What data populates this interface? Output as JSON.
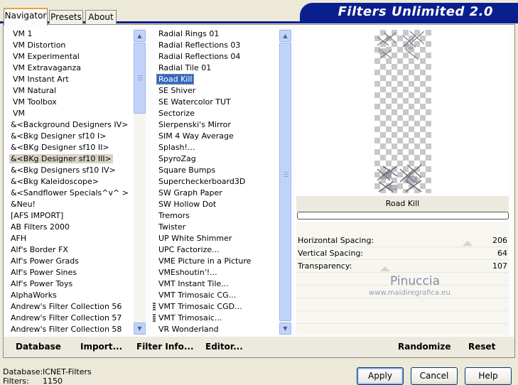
{
  "header": {
    "title": "Filters Unlimited 2.0"
  },
  "tabs": [
    {
      "label": "Navigator",
      "active": true
    },
    {
      "label": "Presets",
      "active": false
    },
    {
      "label": "About",
      "active": false
    }
  ],
  "categories": [
    "VM 1",
    "VM Distortion",
    "VM Experimental",
    "VM Extravaganza",
    "VM Instant Art",
    "VM Natural",
    "VM Toolbox",
    "VM",
    "&<Background Designers IV>",
    "&<Bkg Designer sf10 I>",
    "&<BKg Designer sf10 II>",
    "&<BKg Designer sf10 III>",
    "&<Bkg Designers sf10 IV>",
    "&<Bkg Kaleidoscope>",
    "&<Sandflower Specials^v^ >",
    "&Neu!",
    "[AFS IMPORT]",
    "AB Filters 2000",
    "AFH",
    "Alf's Border FX",
    "Alf's Power Grads",
    "Alf's Power Sines",
    "Alf's Power Toys",
    "AlphaWorks",
    "Andrew's Filter Collection 56",
    "Andrew's Filter Collection 57",
    "Andrew's Filter Collection 58"
  ],
  "filters": [
    "Radial  Rings 01",
    "Radial Reflections 03",
    "Radial Reflections 04",
    "Radial Tile 01",
    "Road Kill",
    "SE Shiver",
    "SE Watercolor TUT",
    "Sectorize",
    "Sierpenski's Mirror",
    "SIM 4 Way Average",
    "Splash!...",
    "SpyroZag",
    "Square Bumps",
    "Supercheckerboard3D",
    "SW Graph Paper",
    "SW Hollow Dot",
    "Tremors",
    "Twister",
    "UP White Shimmer",
    "UPC Factorize...",
    "VME Picture in a Picture",
    "VMEshoutin'!...",
    "VMT Instant Tile...",
    "VMT Trimosaic CG...",
    "VMT Trimosaic CGD...",
    "VMT Trimosaic...",
    "VR Wonderland"
  ],
  "selected_filter": "Road Kill",
  "params": [
    {
      "label": "Horizontal Spacing:",
      "value": "206"
    },
    {
      "label": "Vertical Spacing:",
      "value": "64"
    },
    {
      "label": "Transparency:",
      "value": "107"
    }
  ],
  "watermark": {
    "name": "Pinuccia",
    "url": "www.maidiregrafica.eu"
  },
  "toolbar": {
    "database": "Database",
    "import": "Import...",
    "filter_info": "Filter Info...",
    "editor": "Editor...",
    "randomize": "Randomize",
    "reset": "Reset"
  },
  "status": {
    "database_label": "Database:",
    "database_value": "ICNET-Filters",
    "filters_label": "Filters:",
    "filters_value": "1150"
  },
  "buttons": {
    "apply": "Apply",
    "cancel": "Cancel",
    "help": "Help"
  }
}
